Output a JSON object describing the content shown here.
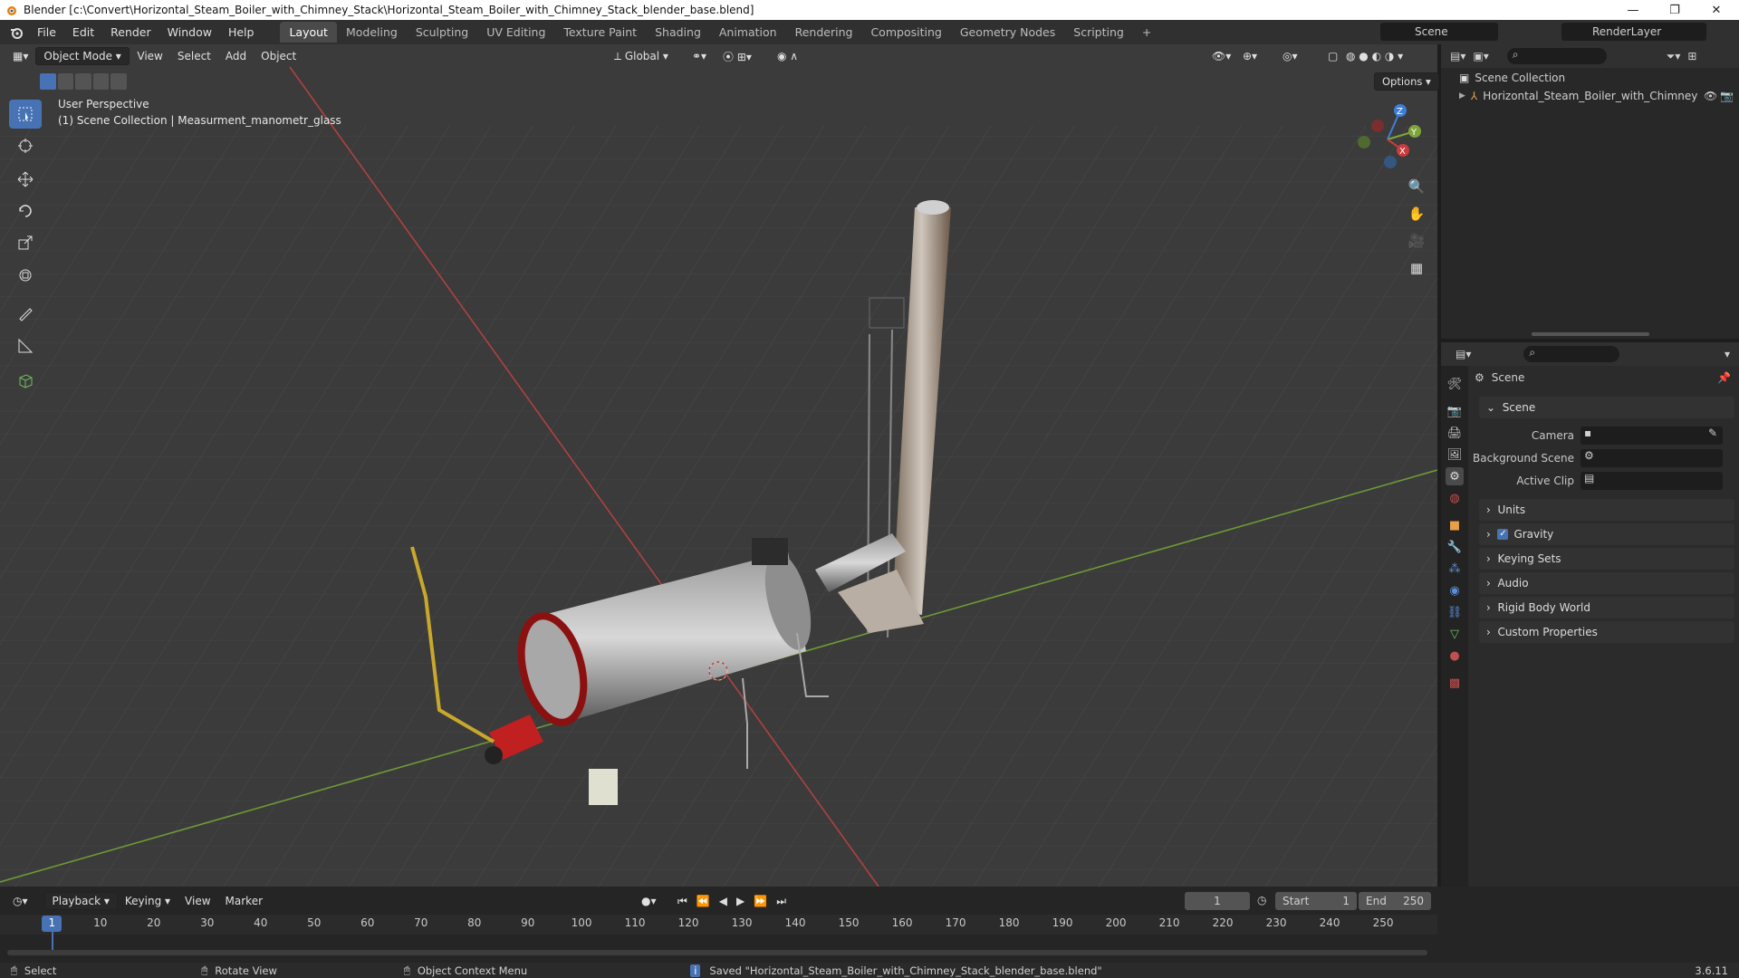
{
  "window": {
    "title": "Blender [c:\\Convert\\Horizontal_Steam_Boiler_with_Chimney_Stack\\Horizontal_Steam_Boiler_with_Chimney_Stack_blender_base.blend]",
    "minimize": "—",
    "maximize": "❐",
    "close": "✕"
  },
  "menu": [
    "File",
    "Edit",
    "Render",
    "Window",
    "Help"
  ],
  "workspaces": [
    "Layout",
    "Modeling",
    "Sculpting",
    "UV Editing",
    "Texture Paint",
    "Shading",
    "Animation",
    "Rendering",
    "Compositing",
    "Geometry Nodes",
    "Scripting"
  ],
  "active_workspace": "Layout",
  "scene_selector": "Scene",
  "view_layer": "RenderLayer",
  "viewport": {
    "mode": "Object Mode",
    "menus": [
      "View",
      "Select",
      "Add",
      "Object"
    ],
    "transform_orientation": "Global",
    "options": "Options",
    "overlay_line1": "User Perspective",
    "overlay_line2": "(1) Scene Collection | Measurment_manometr_glass",
    "gizmo": {
      "x": "X",
      "y": "Y",
      "z": "Z"
    }
  },
  "outliner": {
    "root": "Scene Collection",
    "items": [
      {
        "label": "Horizontal_Steam_Boiler_with_Chimney"
      }
    ]
  },
  "properties": {
    "header": "Scene",
    "section": "Scene",
    "fields": {
      "camera": "Camera",
      "background_scene": "Background Scene",
      "active_clip": "Active Clip"
    },
    "panels": [
      "Units",
      "Gravity",
      "Keying Sets",
      "Audio",
      "Rigid Body World",
      "Custom Properties"
    ],
    "gravity_checked": true
  },
  "timeline": {
    "menus": [
      "Playback",
      "Keying",
      "View",
      "Marker"
    ],
    "current_frame": "1",
    "start_label": "Start",
    "start": "1",
    "end_label": "End",
    "end": "250",
    "ticks": [
      "1",
      "10",
      "20",
      "30",
      "40",
      "50",
      "60",
      "70",
      "80",
      "90",
      "100",
      "110",
      "120",
      "130",
      "140",
      "150",
      "160",
      "170",
      "180",
      "190",
      "200",
      "210",
      "220",
      "230",
      "240",
      "250"
    ]
  },
  "status": {
    "select": "Select",
    "rotate": "Rotate View",
    "context": "Object Context Menu",
    "message": "Saved \"Horizontal_Steam_Boiler_with_Chimney_Stack_blender_base.blend\"",
    "version": "3.6.11"
  },
  "colors": {
    "accent": "#4772b3",
    "x_axis": "#c83c3c",
    "y_axis": "#7fa53a",
    "z_axis": "#3f7ed6"
  }
}
